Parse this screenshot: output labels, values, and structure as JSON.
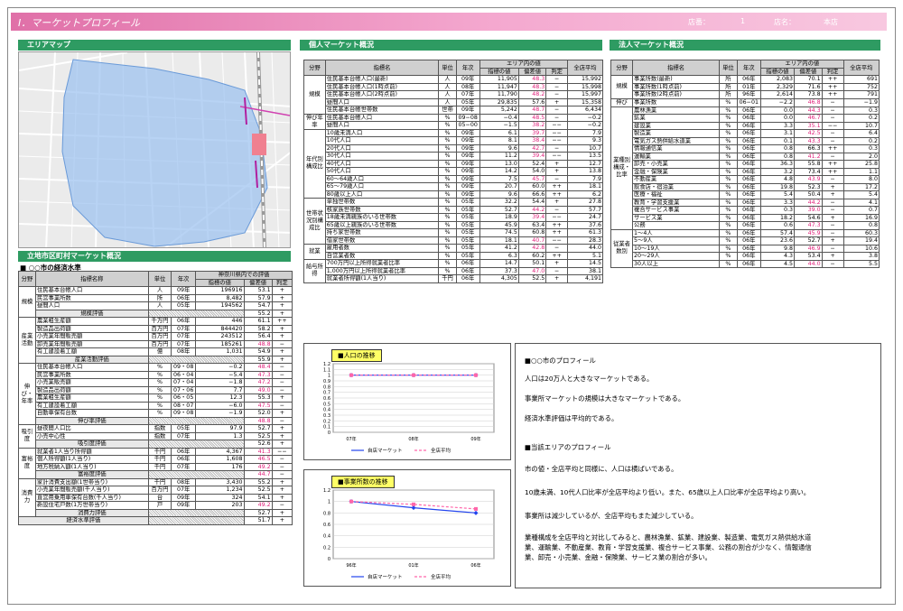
{
  "header": {
    "title": "Ⅰ．マーケットプロフィール",
    "store_label": "店番：",
    "store_no": "1",
    "name_label": "店名：",
    "name": "本店"
  },
  "area_map": {
    "title": "エリアマップ"
  },
  "city": {
    "title": "立地市区町村マーケット概況",
    "subtitle": "■ ○○市の経済水準",
    "h_cat": "分野",
    "h_name": "指標名称",
    "h_unit": "単位",
    "h_year": "年次",
    "h_pref": "神奈川県内での評価",
    "h_val": "指標の値",
    "h_dev": "偏差値",
    "h_judge": "判定",
    "groups": [
      {
        "cat": "規模",
        "rows": [
          [
            "住民基本台帳人口",
            "人",
            "09年",
            "196916",
            "53.1",
            "+"
          ],
          [
            "民営事業所数",
            "所",
            "06年",
            "8,482",
            "57.9",
            "+"
          ],
          [
            "昼間人口",
            "人",
            "05年",
            "194562",
            "54.7",
            "+"
          ]
        ],
        "summary": [
          "規模評価",
          "55.2",
          "+"
        ]
      },
      {
        "cat": "産業活動",
        "rows": [
          [
            "農業粗生産額",
            "千万円",
            "06年",
            "446",
            "61.1",
            "++"
          ],
          [
            "製造品出荷額",
            "百万円",
            "07年",
            "844420",
            "58.2",
            "+"
          ],
          [
            "小売業年間販売額",
            "百万円",
            "07年",
            "243512",
            "56.4",
            "+"
          ],
          [
            "卸売業年間販売額",
            "百万円",
            "07年",
            "185261",
            "48.8",
            "−"
          ],
          [
            "有工建設着工額",
            "億",
            "08年",
            "1,031",
            "54.9",
            "+"
          ]
        ],
        "summary": [
          "産業活動評価",
          "55.9",
          "+"
        ]
      },
      {
        "cat": "伸び・年率",
        "rows": [
          [
            "住民基本台帳人口",
            "%",
            "09・08",
            "−0.2",
            "48.4",
            "−"
          ],
          [
            "民営事業所数",
            "%",
            "06・04",
            "−5.4",
            "47.3",
            "−"
          ],
          [
            "小売業販売額",
            "%",
            "07・04",
            "−1.8",
            "47.2",
            "−"
          ],
          [
            "製造品出荷額",
            "%",
            "07・06",
            "7.7",
            "49.0",
            "−"
          ],
          [
            "農業粗生産額",
            "%",
            "06・05",
            "12.3",
            "55.3",
            "+"
          ],
          [
            "有工建設着工額",
            "%",
            "08・07",
            "−6.0",
            "47.5",
            "−"
          ],
          [
            "自動車保有台数",
            "%",
            "09・08",
            "−1.9",
            "52.0",
            "+"
          ]
        ],
        "summary": [
          "伸び率評価",
          "48.8",
          "−"
        ]
      },
      {
        "cat": "吸引度",
        "rows": [
          [
            "昼夜間人口比",
            "指数",
            "05年",
            "97.9",
            "52.7",
            "+"
          ],
          [
            "小売中心性",
            "指数",
            "07年",
            "1.3",
            "52.5",
            "+"
          ]
        ],
        "summary": [
          "吸引度評価",
          "52.6",
          "+"
        ]
      },
      {
        "cat": "富裕度",
        "rows": [
          [
            "就業者1人当り所得額",
            "千円",
            "06年",
            "4,367",
            "41.3",
            "−−"
          ],
          [
            "個人所得額(1人当り)",
            "千円",
            "06年",
            "1,608",
            "46.5",
            "−"
          ],
          [
            "地方税納入額(1人当り)",
            "千円",
            "07年",
            "176",
            "49.2",
            "−"
          ]
        ],
        "summary": [
          "富裕度評価",
          "44.7",
          "−"
        ]
      },
      {
        "cat": "消費力",
        "rows": [
          [
            "家計消費支出額(1世帯当り)",
            "千円",
            "08年",
            "3,430",
            "55.2",
            "+"
          ],
          [
            "小売業年間販売額(千人当り)",
            "百万円",
            "07年",
            "1,234",
            "52.5",
            "+"
          ],
          [
            "直営用乗用車保有台数(千人当り)",
            "台",
            "09年",
            "324",
            "54.1",
            "+"
          ],
          [
            "新設住宅戸数(1万世帯当り)",
            "戸",
            "09年",
            "203",
            "49.2",
            "−"
          ]
        ],
        "summary": [
          "消費力評価",
          "52.7",
          "+"
        ]
      }
    ],
    "total": [
      "経済水準評価",
      "51.7",
      "+"
    ]
  },
  "personal": {
    "title": "個人マーケット概況",
    "h_cat": "分野",
    "h_name": "指標名",
    "h_unit": "単位",
    "h_year": "年次",
    "h_area": "エリア内の値",
    "h_val": "指標の値",
    "h_dev": "偏差値",
    "h_judge": "判定",
    "h_avg": "全店平均",
    "groups": [
      {
        "cat": "規模",
        "rows": [
          [
            "住民基本台帳人口(最新)",
            "人",
            "09年",
            "11,905",
            "48.3",
            "−",
            "15,992"
          ],
          [
            "住民基本台帳人口(1時点前)",
            "人",
            "08年",
            "11,947",
            "48.3",
            "−",
            "15,998"
          ],
          [
            "住民基本台帳人口(2時点前)",
            "人",
            "07年",
            "11,790",
            "48.2",
            "−",
            "15,997"
          ],
          [
            "昼間人口",
            "人",
            "05年",
            "29,835",
            "57.6",
            "+",
            "15,358"
          ],
          [
            "住民基本台帳世帯数",
            "世帯",
            "09年",
            "5,242",
            "48.7",
            "−",
            "6,434"
          ]
        ]
      },
      {
        "cat": "伸び年率",
        "rows": [
          [
            "住民基本台帳人口",
            "%",
            "09−08",
            "−0.4",
            "48.5",
            "−",
            "−0.2"
          ],
          [
            "昼間人口",
            "%",
            "05−00",
            "−1.5",
            "38.2",
            "−−",
            "−0.2"
          ]
        ]
      },
      {
        "cat": "年代別構成比",
        "rows": [
          [
            "10歳未満人口",
            "%",
            "09年",
            "6.1",
            "39.7",
            "−−",
            "7.9"
          ],
          [
            "10代人口",
            "%",
            "09年",
            "8.1",
            "38.4",
            "−−",
            "9.3"
          ],
          [
            "20代人口",
            "%",
            "09年",
            "9.6",
            "42.7",
            "−",
            "10.7"
          ],
          [
            "30代人口",
            "%",
            "09年",
            "11.2",
            "39.4",
            "−−",
            "13.5"
          ],
          [
            "40代人口",
            "%",
            "09年",
            "13.0",
            "52.4",
            "+",
            "12.7"
          ],
          [
            "50代人口",
            "%",
            "09年",
            "14.2",
            "54.0",
            "+",
            "13.8"
          ],
          [
            "60〜64歳人口",
            "%",
            "09年",
            "7.5",
            "45.7",
            "−",
            "7.9"
          ],
          [
            "65〜79歳人口",
            "%",
            "09年",
            "20.7",
            "60.0",
            "++",
            "18.1"
          ],
          [
            "80歳以上人口",
            "%",
            "09年",
            "9.6",
            "66.6",
            "++",
            "6.2"
          ]
        ]
      },
      {
        "cat": "世帯状況別構成比",
        "rows": [
          [
            "単独世帯数",
            "%",
            "05年",
            "32.2",
            "54.4",
            "+",
            "27.8"
          ],
          [
            "核家族世帯数",
            "%",
            "05年",
            "52.7",
            "44.2",
            "−",
            "57.7"
          ],
          [
            "18歳未満親族のいる世帯数",
            "%",
            "05年",
            "18.9",
            "39.4",
            "−−",
            "24.7"
          ],
          [
            "65歳以上親族のいる世帯数",
            "%",
            "05年",
            "45.9",
            "63.4",
            "++",
            "37.6"
          ],
          [
            "持ち家世帯数",
            "%",
            "05年",
            "74.5",
            "60.8",
            "++",
            "61.3"
          ],
          [
            "借家世帯数",
            "%",
            "05年",
            "18.1",
            "40.7",
            "−−",
            "28.3"
          ]
        ]
      },
      {
        "cat": "就業",
        "rows": [
          [
            "雇用者数",
            "%",
            "05年",
            "41.2",
            "42.8",
            "−",
            "44.0"
          ],
          [
            "自営業者数",
            "%",
            "05年",
            "6.3",
            "60.2",
            "++",
            "5.1"
          ]
        ]
      },
      {
        "cat": "給与所得",
        "rows": [
          [
            "700万円以上所得就業者比率",
            "%",
            "06年",
            "14.7",
            "50.1",
            "+",
            "14.5"
          ],
          [
            "1,000万円以上所得就業者比率",
            "%",
            "06年",
            "37.3",
            "47.0",
            "−",
            "38.1"
          ],
          [
            "就業者所得額(1人当り)",
            "千円",
            "06年",
            "4,305",
            "52.5",
            "+",
            "4,191"
          ]
        ]
      }
    ]
  },
  "corporate": {
    "title": "法人マーケット概況",
    "h_cat": "分野",
    "h_name": "指標名",
    "h_unit": "単位",
    "h_year": "年次",
    "h_area": "エリア内の値",
    "h_val": "指標の値",
    "h_dev": "偏差値",
    "h_judge": "判定",
    "h_avg": "全店平均",
    "groups": [
      {
        "cat": "規模",
        "rows": [
          [
            "事業所数(最新)",
            "所",
            "06年",
            "2,083",
            "70.1",
            "++",
            "691"
          ],
          [
            "事業所数(1時点前)",
            "所",
            "01年",
            "2,329",
            "71.6",
            "++",
            "752"
          ],
          [
            "事業所数(2時点前)",
            "所",
            "96年",
            "2,614",
            "73.8",
            "++",
            "791"
          ]
        ]
      },
      {
        "cat": "伸び",
        "rows": [
          [
            "事業所数",
            "%",
            "06−01",
            "−2.2",
            "46.8",
            "−",
            "−1.9"
          ]
        ]
      },
      {
        "cat": "業種別構成・比率",
        "rows": [
          [
            "農林漁業",
            "%",
            "06年",
            "0.0",
            "44.3",
            "−",
            "0.3"
          ],
          [
            "鉱業",
            "%",
            "06年",
            "0.0",
            "46.7",
            "−",
            "0.2"
          ],
          [
            "建設業",
            "%",
            "06年",
            "3.3",
            "35.1",
            "−−",
            "10.7"
          ],
          [
            "製造業",
            "%",
            "06年",
            "3.1",
            "42.5",
            "−",
            "6.4"
          ],
          [
            "電気ガス熱供給水道業",
            "%",
            "06年",
            "0.1",
            "43.3",
            "−",
            "0.2"
          ],
          [
            "情報通信業",
            "%",
            "06年",
            "0.8",
            "66.3",
            "++",
            "0.3"
          ],
          [
            "運輸業",
            "%",
            "06年",
            "0.8",
            "41.2",
            "−",
            "2.0"
          ],
          [
            "卸売・小売業",
            "%",
            "06年",
            "36.3",
            "55.8",
            "++",
            "25.8"
          ],
          [
            "金融・保険業",
            "%",
            "06年",
            "3.2",
            "73.4",
            "++",
            "1.1"
          ],
          [
            "不動産業",
            "%",
            "06年",
            "4.8",
            "43.9",
            "−",
            "8.0"
          ],
          [
            "飲食店・宿泊業",
            "%",
            "06年",
            "19.8",
            "52.3",
            "+",
            "17.2"
          ],
          [
            "医療・福祉",
            "%",
            "06年",
            "5.4",
            "50.4",
            "+",
            "5.4"
          ],
          [
            "教育・学習支援業",
            "%",
            "06年",
            "3.3",
            "44.2",
            "−",
            "4.1"
          ],
          [
            "複合サービス事業",
            "%",
            "06年",
            "0.3",
            "39.0",
            "−",
            "0.7"
          ],
          [
            "サービス業",
            "%",
            "06年",
            "18.2",
            "54.6",
            "+",
            "16.9"
          ],
          [
            "公務",
            "%",
            "06年",
            "0.6",
            "47.3",
            "−",
            "0.8"
          ]
        ]
      },
      {
        "cat": "従業者数別",
        "rows": [
          [
            "1〜4人",
            "%",
            "06年",
            "57.4",
            "45.9",
            "−",
            "60.3"
          ],
          [
            "5〜9人",
            "%",
            "06年",
            "23.6",
            "52.7",
            "+",
            "19.4"
          ],
          [
            "10〜19人",
            "%",
            "06年",
            "9.8",
            "46.9",
            "−",
            "10.6"
          ],
          [
            "20〜29人",
            "%",
            "06年",
            "4.3",
            "53.4",
            "+",
            "3.8"
          ],
          [
            "30人以上",
            "%",
            "06年",
            "4.5",
            "44.0",
            "−",
            "5.5"
          ]
        ]
      }
    ]
  },
  "chart1": {
    "title": "■人口の推移",
    "yticks": [
      "1.2",
      "1.1",
      "1",
      "0.9",
      "0.8",
      "0.7",
      "0.6",
      "0.5",
      "0.4",
      "0.3",
      "0.2",
      "0.1",
      "0"
    ],
    "x": [
      "07年",
      "08年",
      "09年"
    ],
    "legend_a": "自店マーケット",
    "legend_b": "全店平均"
  },
  "chart2": {
    "title": "■事業所数の推移",
    "yticks": [
      "1.2",
      "1",
      "0.8",
      "0.6",
      "0.4",
      "0.2",
      "0"
    ],
    "x": [
      "96年",
      "01年",
      "06年"
    ],
    "legend_a": "自店マーケット",
    "legend_b": "全店平均"
  },
  "chart_data": [
    {
      "type": "line",
      "title": "■人口の推移",
      "categories": [
        "07年",
        "08年",
        "09年"
      ],
      "ylim": [
        0,
        1.2
      ],
      "series": [
        {
          "name": "自店マーケット",
          "values": [
            1.0,
            1.0,
            1.0
          ],
          "color": "#2244ee"
        },
        {
          "name": "全店平均",
          "values": [
            1.0,
            1.0,
            1.0
          ],
          "color": "#ff66aa"
        }
      ]
    },
    {
      "type": "line",
      "title": "■事業所数の推移",
      "categories": [
        "96年",
        "01年",
        "06年"
      ],
      "ylim": [
        0,
        1.2
      ],
      "series": [
        {
          "name": "自店マーケット",
          "values": [
            1.0,
            0.89,
            0.8
          ],
          "color": "#2244ee"
        },
        {
          "name": "全店平均",
          "values": [
            1.0,
            0.95,
            0.87
          ],
          "color": "#ff66aa"
        }
      ]
    }
  ],
  "profile": {
    "h1": "■○○市のプロフィール",
    "p1": "人口は20万人と大きなマーケットである。",
    "p2": "事業所マーケットの規模は大きなマーケットである。",
    "p3": "経済水準評価は平均的である。",
    "h2": "■当該エリアのプロフィール",
    "p4": "市の値・全店平均と同様に、人口は横ばいである。",
    "p5": "10歳未満、10代人口比率が全店平均より低い。また、65歳以上人口比率が全店平均より高い。",
    "p6": "事業所は減少しているが、全店平均もまた減少している。",
    "p7": "業種構成を全店平均と対比してみると、農林漁業、鉱業、建設業、製造業、電気ガス熱供給水道",
    "p8": "業、運輸業、不動産業、教育・学習支援業、複合サービス事業、公務の割合が少なく、情報通信",
    "p9": "業、卸売・小売業、金融・保険業、サービス業の割合が多い。"
  }
}
